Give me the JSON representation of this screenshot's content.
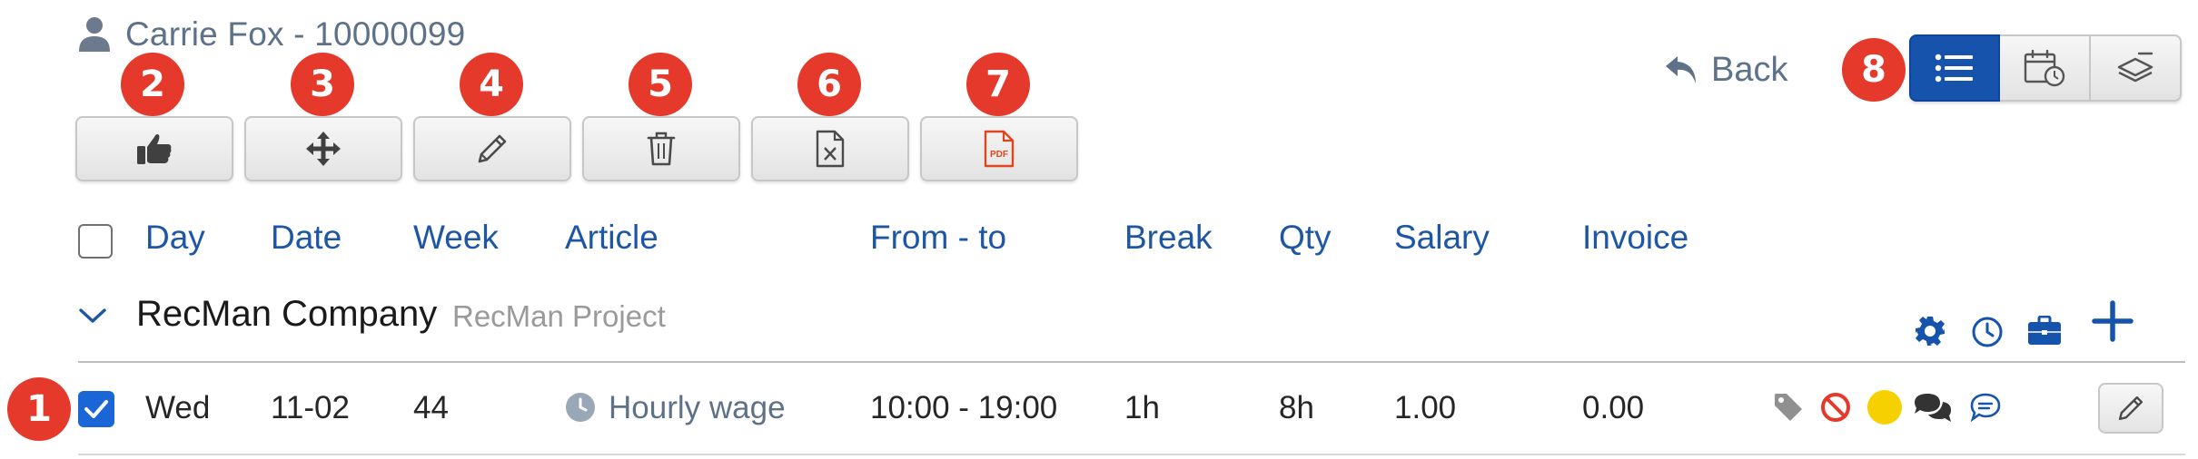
{
  "header": {
    "user_name": "Carrie Fox - 10000099",
    "user_icon": "person-icon"
  },
  "toolbar": {
    "buttons": [
      {
        "icon": "thumbs-up-icon",
        "marker": "2"
      },
      {
        "icon": "move-icon",
        "marker": "3"
      },
      {
        "icon": "pencil-icon",
        "marker": "4"
      },
      {
        "icon": "trash-icon",
        "marker": "5"
      },
      {
        "icon": "excel-file-icon",
        "marker": "6"
      },
      {
        "icon": "pdf-file-icon",
        "marker": "7",
        "icon_text": "PDF"
      }
    ]
  },
  "back": {
    "label": "Back",
    "icon": "undo-arrow-icon"
  },
  "view_toggle": {
    "marker": "8",
    "buttons": [
      {
        "icon": "list-icon",
        "active": true
      },
      {
        "icon": "calendar-clock-icon",
        "active": false
      },
      {
        "icon": "layers-icon",
        "active": false
      }
    ]
  },
  "columns": [
    "Day",
    "Date",
    "Week",
    "Article",
    "From - to",
    "Break",
    "Qty",
    "Salary",
    "Invoice"
  ],
  "group": {
    "company": "RecMan Company",
    "project": "RecMan Project",
    "icons": [
      "gear-icon",
      "clock-icon",
      "briefcase-icon",
      "plus-icon"
    ]
  },
  "rows": [
    {
      "marker": "1",
      "checked": true,
      "day": "Wed",
      "date": "11-02",
      "week": "44",
      "article": "Hourly wage",
      "from_to": "10:00 - 19:00",
      "break": "1h",
      "qty": "8h",
      "salary": "1.00",
      "invoice": "0.00",
      "status_icons": [
        "tag-icon",
        "ban-icon",
        "status-dot-icon",
        "comments-icon",
        "chat-bubble-icon"
      ],
      "status_dot_color": "#f7d000"
    }
  ],
  "colors": {
    "accent": "#1553ad",
    "link": "#1e56a6",
    "marker": "#e4392b",
    "muted": "#5d7188"
  }
}
